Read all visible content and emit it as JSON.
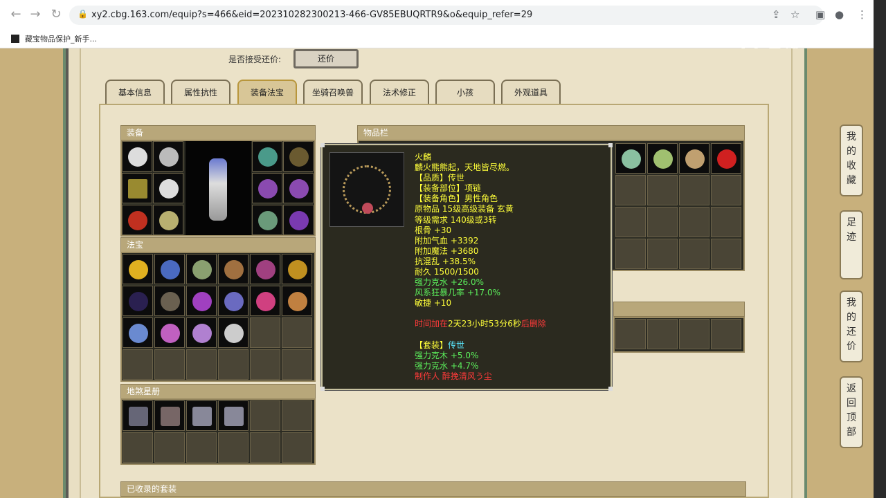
{
  "browser": {
    "url": "xy2.cbg.163.com/equip?s=466&eid=202310282300213-466-GV85EBUQRTR9&o&equip_refer=29",
    "bookmark": "藏宝物品保护_新手..."
  },
  "watermark": "CC直播",
  "bargain": {
    "label": "是否接受还价:",
    "button": "还价"
  },
  "tabs": [
    "基本信息",
    "属性抗性",
    "装备法宝",
    "坐骑召唤兽",
    "法术修正",
    "小孩",
    "外观道具"
  ],
  "sections": {
    "equipment": "装备",
    "fabao": "法宝",
    "disha": "地煞星册",
    "inventory": "物品栏",
    "collected": "已收录的套装"
  },
  "tooltip": {
    "name": "火麟",
    "desc": "麟火熊熊起，天地皆尽燃。",
    "quality": "【品质】传世",
    "slot": "【装备部位】项链",
    "role": "【装备角色】男性角色",
    "origin": "原物品 15级高级装备 玄黄",
    "req": "等级需求 140级或3转",
    "stats": [
      "根骨 +30",
      "附加气血 +3392",
      "附加魔法 +3680",
      "抗混乱 +38.5%",
      "耐久 1500/1500"
    ],
    "bonus": [
      "强力克水 +26.0%",
      "风系狂暴几率 +17.0%"
    ],
    "agility": "敏捷 +10",
    "time_prefix": "时间加在",
    "time": "2天23小时53分6秒",
    "time_suffix": "后删除",
    "set_label": "【套装】",
    "set_name": "传世",
    "set_stats": [
      "强力克木 +5.0%",
      "强力克水 +4.7%"
    ],
    "maker": "制作人 醉挽清风う尘"
  },
  "side_buttons": [
    "我的收藏",
    "足迹",
    "我的还价",
    "返回顶部"
  ],
  "colors": {
    "gold_tab": "#d8c697",
    "yellow": "#ffff3a",
    "green": "#5cf05c",
    "red": "#ff3a3a",
    "cyan": "#5ae8ff"
  }
}
